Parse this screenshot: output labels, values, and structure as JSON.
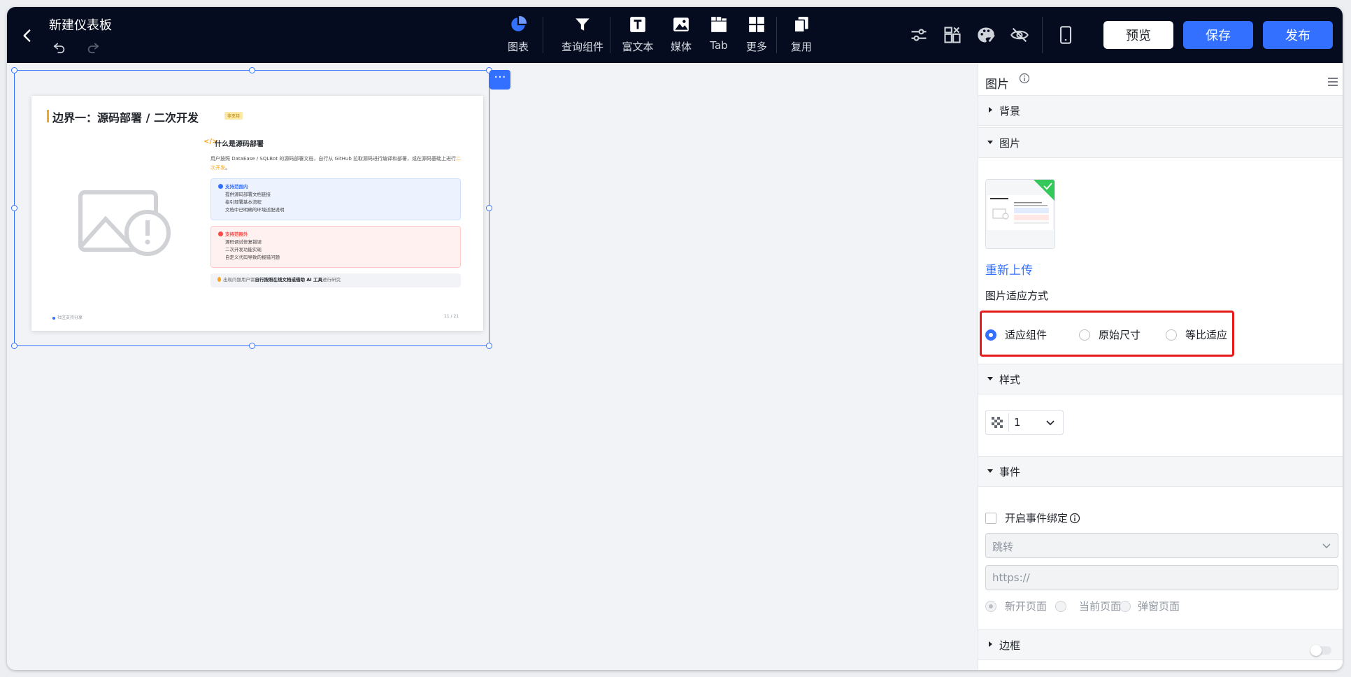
{
  "header": {
    "title": "新建仪表板",
    "tools": [
      {
        "label": "图表",
        "icon": "pie-chart-icon"
      },
      {
        "label": "查询组件",
        "icon": "filter-icon"
      },
      {
        "label": "富文本",
        "icon": "rich-text-icon"
      },
      {
        "label": "媒体",
        "icon": "image-icon"
      },
      {
        "label": "Tab",
        "icon": "tab-icon"
      },
      {
        "label": "更多",
        "icon": "grid-icon"
      },
      {
        "label": "复用",
        "icon": "copy-icon"
      }
    ],
    "preview_label": "预览",
    "save_label": "保存",
    "publish_label": "发布"
  },
  "slide": {
    "title": "边界一：源码部署 / 二次开发",
    "tag": "非支持",
    "section_title": "什么是源码部署",
    "paragraph_a": "用户按照 DataEase / SQLBot 的源码部署文档，自行从 GitHub 拉取源码进行编译和部署，或在源码基础上进行",
    "paragraph_hl": "二次开发",
    "paragraph_b": "。",
    "in_scope_title": "支持范围内",
    "in_scope_items": [
      "提供源码部署文档链接",
      "指引部署基本流程",
      "文档中已明确的环境适配说明"
    ],
    "out_scope_title": "支持范围外",
    "out_scope_items": [
      "源码调试修复错误",
      "二次开发功能实现",
      "自定义代码导致的报错问题"
    ],
    "tip_a": "出现问题用户需",
    "tip_b": "自行按照在线文档或借助 AI 工具",
    "tip_c": "进行研究",
    "footer": "社区支持分享",
    "page": "11 / 21"
  },
  "panel": {
    "title": "图片",
    "sections": {
      "background": "背景",
      "image": "图片",
      "style": "样式",
      "event": "事件",
      "border": "边框"
    },
    "reupload_label": "重新上传",
    "fit_label": "图片适应方式",
    "fit_options": [
      "适应组件",
      "原始尺寸",
      "等比适应"
    ],
    "fit_selected": "适应组件",
    "style_value": "1",
    "event_bind_label": "开启事件绑定",
    "event_type": "跳转",
    "url_placeholder": "https://",
    "open_options": [
      "新开页面",
      "当前页面",
      "弹窗页面"
    ],
    "open_selected": "新开页面"
  },
  "colors": {
    "topbar": "#050c1f",
    "primary": "#3370ff",
    "highlight_border": "#e51a1a",
    "accent": "#f5a623"
  }
}
